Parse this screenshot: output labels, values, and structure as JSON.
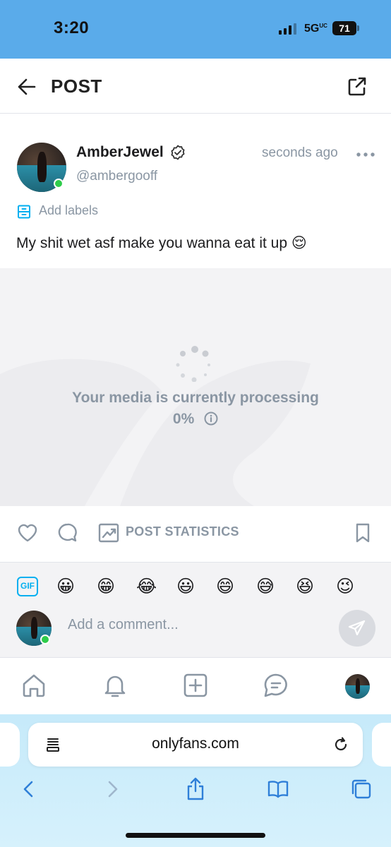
{
  "status_bar": {
    "time": "3:20",
    "network": "5G",
    "network_suffix": "UC",
    "battery": "71"
  },
  "header": {
    "title": "POST"
  },
  "post": {
    "author": "AmberJewel",
    "handle": "@ambergooff",
    "time_ago": "seconds ago",
    "add_labels": "Add labels",
    "text": "My shit wet asf make you wanna eat it up 😌"
  },
  "media": {
    "processing_text": "Your media is currently processing",
    "progress": "0%"
  },
  "actions": {
    "stats_label": "POST STATISTICS"
  },
  "comment": {
    "gif_label": "GIF",
    "emojis": [
      "😀",
      "😁",
      "😂",
      "😃",
      "😄",
      "😅",
      "😆",
      "😉"
    ],
    "placeholder": "Add a comment..."
  },
  "browser": {
    "url": "onlyfans.com"
  },
  "colors": {
    "accent": "#00aff0",
    "muted": "#8a96a3",
    "status_bar": "#5aabea",
    "online": "#2ecc4a",
    "safari_blue": "#2f7fd8"
  }
}
